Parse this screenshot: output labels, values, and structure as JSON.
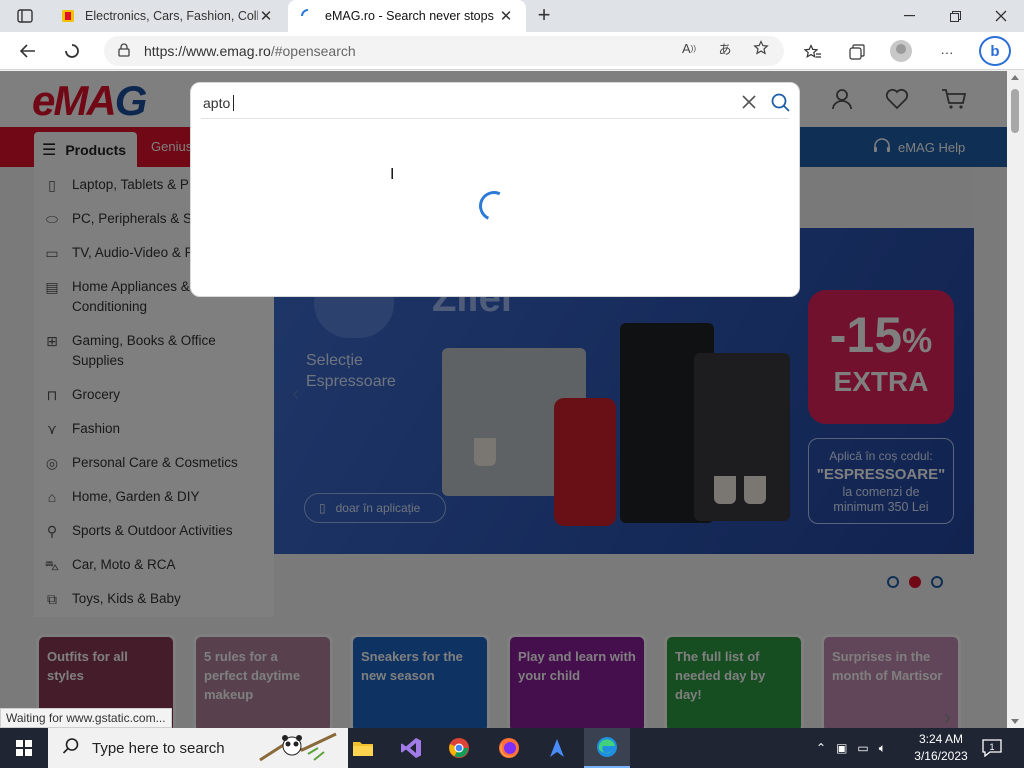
{
  "browser": {
    "tabs": [
      {
        "title": "Electronics, Cars, Fashion, Collect",
        "active": false
      },
      {
        "title": "eMAG.ro - Search never stops",
        "active": true
      }
    ],
    "url_host": "https://www.emag.ro",
    "url_path": "/#opensearch"
  },
  "site": {
    "logo": {
      "e": "eMA",
      "g": "G"
    },
    "products_label": "Products",
    "genius_label": "Genius",
    "help_label": "eMAG Help",
    "categories": [
      {
        "label": "Laptop, Tablets & P",
        "icon": "phone-icon"
      },
      {
        "label": "PC, Peripherals & S",
        "icon": "mouse-icon"
      },
      {
        "label": "TV, Audio-Video & P",
        "icon": "tv-icon"
      },
      {
        "label": "Home Appliances & Conditioning",
        "icon": "appliance-icon"
      },
      {
        "label": "Gaming, Books & Office Supplies",
        "icon": "gamepad-icon"
      },
      {
        "label": "Grocery",
        "icon": "bag-icon"
      },
      {
        "label": "Fashion",
        "icon": "shirt-icon"
      },
      {
        "label": "Personal Care & Cosmetics",
        "icon": "care-icon"
      },
      {
        "label": "Home, Garden & DIY",
        "icon": "home-icon"
      },
      {
        "label": "Sports & Outdoor Activities",
        "icon": "sports-icon"
      },
      {
        "label": "Car, Moto & RCA",
        "icon": "car-icon"
      },
      {
        "label": "Toys, Kids & Baby",
        "icon": "toys-icon"
      }
    ],
    "banner": {
      "title": "Zilei",
      "subtitle_1": "Selecție",
      "subtitle_2": "Espressoare",
      "app_button": "doar în aplicație",
      "promo_big": "-15",
      "promo_pct": "%",
      "promo_extra": "EXTRA",
      "code_line": "Aplică în coș codul:",
      "code": "\"ESPRESSOARE\"",
      "min_line_1": "la comenzi de",
      "min_line_2": "minimum 350 Lei"
    },
    "cards": [
      {
        "title": "Outfits for all styles",
        "color": "#8a3a55"
      },
      {
        "title": "5 rules for a perfect daytime makeup",
        "color": "#b0839a"
      },
      {
        "title": "Sneakers for the new season",
        "color": "#1c64c4"
      },
      {
        "title": "Play and learn with your child",
        "color": "#8a1e9a"
      },
      {
        "title": "The full list of needed day by day!",
        "color": "#2c9a43"
      },
      {
        "title": "Surprises in the month of Martisor",
        "color": "#c28ab0"
      }
    ]
  },
  "search": {
    "value": "apto",
    "loading": true
  },
  "status_text": "Waiting for www.gstatic.com...",
  "taskbar": {
    "search_placeholder": "Type here to search",
    "time": "3:24 AM",
    "date": "3/16/2023",
    "notifications": "1"
  },
  "colors": {
    "emag_red": "#e0102b",
    "emag_blue": "#1e5fa8",
    "spinner": "#2b7ad8"
  }
}
